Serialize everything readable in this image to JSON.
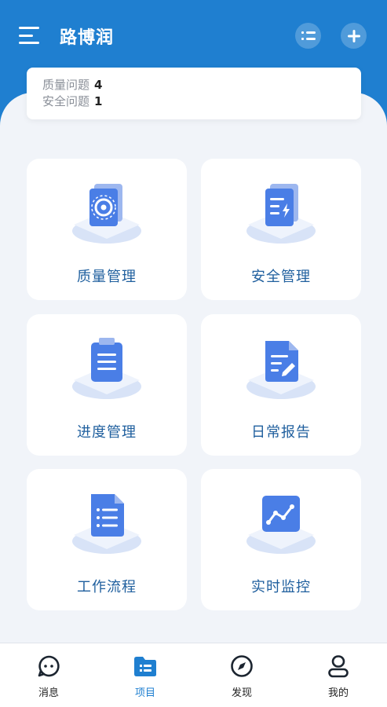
{
  "header": {
    "title": "路博润"
  },
  "summary": [
    {
      "label": "质量问题",
      "value": "4"
    },
    {
      "label": "安全问题",
      "value": "1"
    }
  ],
  "tiles": [
    {
      "label": "质量管理",
      "icon": "quality-management-icon"
    },
    {
      "label": "安全管理",
      "icon": "safety-management-icon"
    },
    {
      "label": "进度管理",
      "icon": "progress-management-icon"
    },
    {
      "label": "日常报告",
      "icon": "daily-report-icon"
    },
    {
      "label": "工作流程",
      "icon": "workflow-icon"
    },
    {
      "label": "实时监控",
      "icon": "realtime-monitor-icon"
    }
  ],
  "nav": [
    {
      "label": "消息",
      "icon": "message-icon"
    },
    {
      "label": "项目",
      "icon": "project-icon"
    },
    {
      "label": "发现",
      "icon": "compass-icon"
    },
    {
      "label": "我的",
      "icon": "profile-icon"
    }
  ],
  "colors": {
    "primary": "#1f7fd0",
    "tile_label": "#1f5f9e",
    "icon_blue": "#4a7ee6"
  }
}
